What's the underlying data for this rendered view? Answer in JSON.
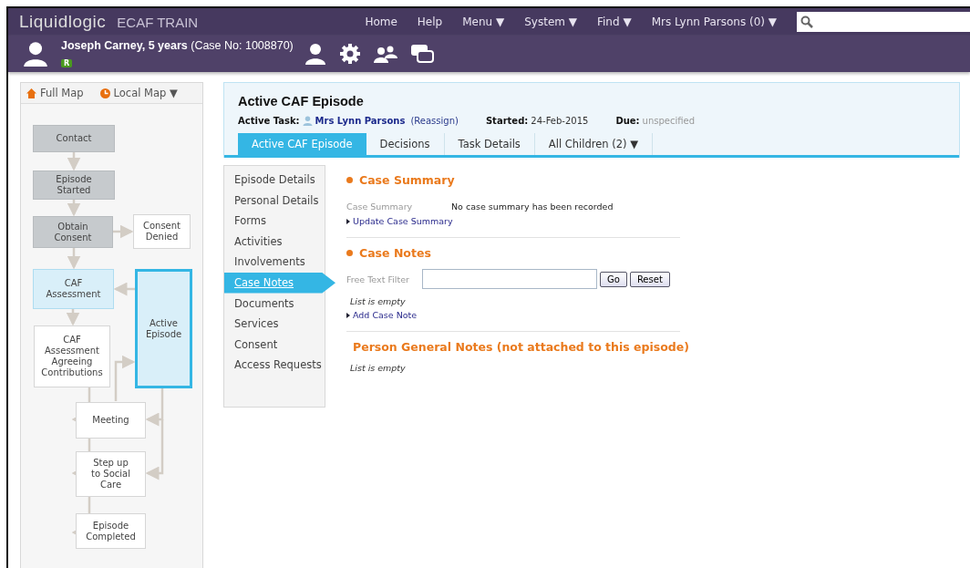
{
  "app": {
    "logo": "Liquidlogic",
    "environment": "ECAF TRAIN"
  },
  "top_nav": [
    "Home",
    "Help",
    "Menu ▼",
    "System ▼",
    "Find ▼",
    "Mrs Lynn Parsons (0) ▼"
  ],
  "person": {
    "name": "Joseph Carney, 5 years",
    "case": "(Case No: 1008870)",
    "badge": "R"
  },
  "map": {
    "tabs": [
      "Full Map",
      "Local Map ▼"
    ],
    "nodes": [
      {
        "label": "Contact",
        "kind": "done"
      },
      {
        "label": "Episode Started",
        "kind": "done"
      },
      {
        "label": "Obtain Consent",
        "kind": "done"
      },
      {
        "label": "Consent Denied",
        "kind": "pending"
      },
      {
        "label": "CAF Assessment",
        "kind": "current"
      },
      {
        "label": "Active Episode",
        "kind": "active"
      },
      {
        "label": "CAF Assessment Agreeing Contributions",
        "kind": "pending"
      },
      {
        "label": "Meeting",
        "kind": "pending"
      },
      {
        "label": "Step up to Social Care",
        "kind": "pending"
      },
      {
        "label": "Episode Completed",
        "kind": "pending"
      }
    ]
  },
  "episode": {
    "title": "Active CAF Episode",
    "task_label": "Active Task:",
    "task_owner": "Mrs Lynn Parsons",
    "reassign": "(Reassign)",
    "started_label": "Started:",
    "started": "24-Feb-2015",
    "due_label": "Due:",
    "due": "unspecified"
  },
  "tabs": [
    {
      "label": "Active CAF Episode",
      "selected": true
    },
    {
      "label": "Decisions",
      "selected": false
    },
    {
      "label": "Task Details",
      "selected": false
    },
    {
      "label": "All Children (2) ▼",
      "selected": false
    }
  ],
  "side_nav": [
    {
      "label": "Episode Details",
      "selected": false
    },
    {
      "label": "Personal Details",
      "selected": false
    },
    {
      "label": "Forms",
      "selected": false
    },
    {
      "label": "Activities",
      "selected": false
    },
    {
      "label": "Involvements",
      "selected": false
    },
    {
      "label": "Case Notes",
      "selected": true
    },
    {
      "label": "Documents",
      "selected": false
    },
    {
      "label": "Services",
      "selected": false
    },
    {
      "label": "Consent",
      "selected": false
    },
    {
      "label": "Access Requests",
      "selected": false
    }
  ],
  "sections": [
    {
      "title": "Case Summary",
      "field_label": "Case Summary",
      "field_value": "No case summary has been recorded",
      "link": "Update Case Summary"
    },
    {
      "title": "Case Notes",
      "filter_label": "Free Text Filter",
      "buttons": [
        "Go",
        "Reset"
      ],
      "empty": "List is empty",
      "link": "Add Case Note"
    },
    {
      "title": "Person General Notes (not attached to this episode)",
      "empty": "List is empty"
    }
  ]
}
